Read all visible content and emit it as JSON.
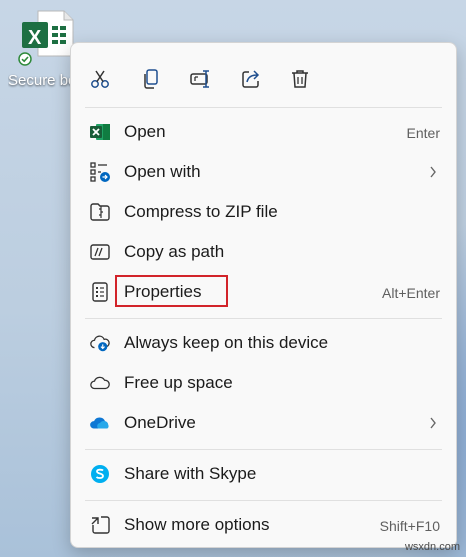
{
  "desktop": {
    "file_label": "Secure bo",
    "excel_letter": "X"
  },
  "toolbar": {
    "cut": "cut-icon",
    "copy": "copy-icon",
    "rename": "rename-icon",
    "share": "share-icon",
    "delete": "delete-icon"
  },
  "menu": {
    "items": [
      {
        "label": "Open",
        "shortcut": "Enter",
        "icon": "excel-icon"
      },
      {
        "label": "Open with",
        "icon": "open-with-icon",
        "submenu": true
      },
      {
        "label": "Compress to ZIP file",
        "icon": "zip-icon"
      },
      {
        "label": "Copy as path",
        "icon": "copy-path-icon"
      },
      {
        "label": "Properties",
        "shortcut": "Alt+Enter",
        "icon": "properties-icon",
        "highlighted": true
      },
      {
        "label": "Always keep on this device",
        "icon": "cloud-sync-icon"
      },
      {
        "label": "Free up space",
        "icon": "cloud-icon"
      },
      {
        "label": "OneDrive",
        "icon": "onedrive-icon",
        "submenu": true
      },
      {
        "label": "Share with Skype",
        "icon": "skype-icon"
      },
      {
        "label": "Show more options",
        "shortcut": "Shift+F10",
        "icon": "more-options-icon"
      }
    ]
  },
  "colors": {
    "accent": "#0067c0",
    "excel_green": "#1d6f42",
    "highlight_box": "#d2232a",
    "onedrive_blue": "#0f78d4",
    "skype_blue": "#00aff0"
  },
  "watermark": "wsxdn.com"
}
